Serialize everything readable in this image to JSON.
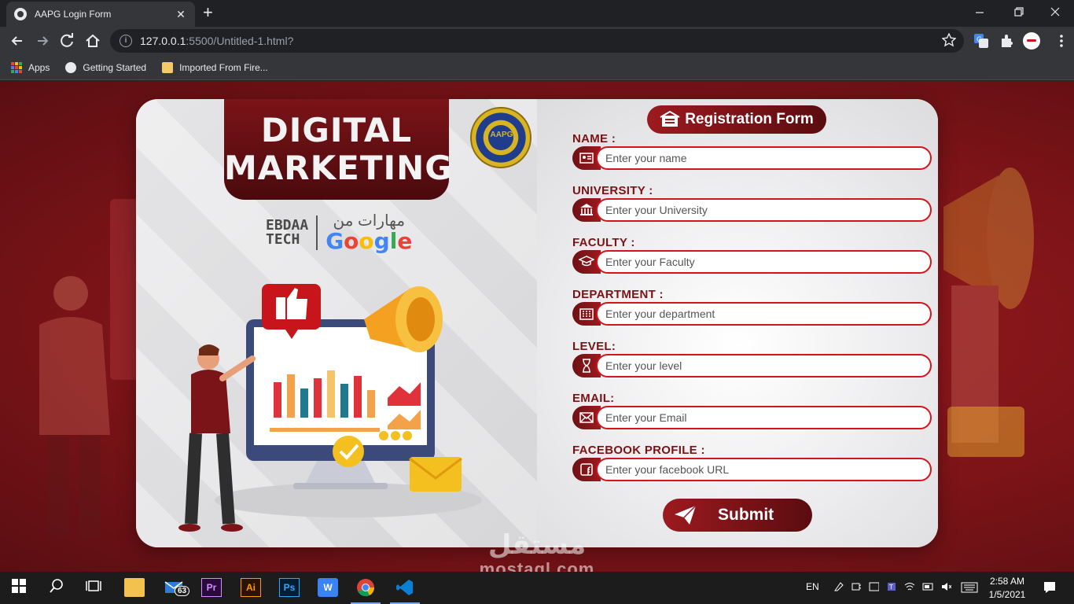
{
  "browser": {
    "tab_title": "AAPG Login Form",
    "tab_close": "✕",
    "new_tab": "+",
    "url_host": "127.0.0.1",
    "url_rest": ":5500/Untitled-1.html?",
    "bookmarks": [
      {
        "label": "Apps"
      },
      {
        "label": "Getting Started"
      },
      {
        "label": "Imported From Fire..."
      }
    ]
  },
  "left": {
    "banner_line1": "DIGITAL",
    "banner_line2": "MARKETING",
    "partner_left_1": "EBDAA",
    "partner_left_2": "TECH",
    "partner_arabic": "مهارات من",
    "partner_google": [
      "G",
      "o",
      "o",
      "g",
      "l",
      "e"
    ],
    "seal_text": "AAPG"
  },
  "form": {
    "title": "Registration Form",
    "fields": [
      {
        "label": "NAME :",
        "placeholder": "Enter your name",
        "icon": "id-card-icon"
      },
      {
        "label": "UNIVERSITY :",
        "placeholder": "Enter your University",
        "icon": "university-icon"
      },
      {
        "label": "FACULTY :",
        "placeholder": "Enter your Faculty",
        "icon": "graduation-cap-icon"
      },
      {
        "label": "DEPARTMENT :",
        "placeholder": "Enter your department",
        "icon": "building-icon"
      },
      {
        "label": "LEVEL:",
        "placeholder": "Enter your level",
        "icon": "hourglass-icon"
      },
      {
        "label": "EMAIL:",
        "placeholder": "Enter your Email",
        "icon": "envelope-icon"
      },
      {
        "label": "FACEBOOK PROFILE :",
        "placeholder": "Enter your facebook URL",
        "icon": "facebook-icon"
      }
    ],
    "submit_label": "Submit"
  },
  "watermark": {
    "arabic": "مستقل",
    "latin": "mostaql.com"
  },
  "taskbar": {
    "mail_badge": "63",
    "lang": "EN",
    "time": "2:58 AM",
    "date": "1/5/2021"
  },
  "colors": {
    "accent": "#9c1a1f",
    "dark_accent": "#5a0c10",
    "input_border": "#d3141c"
  }
}
